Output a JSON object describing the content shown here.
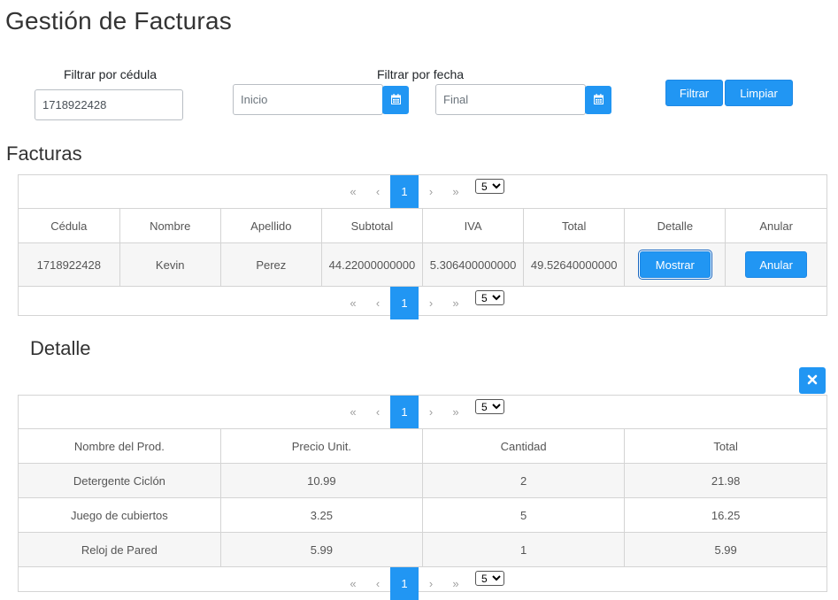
{
  "title": "Gestión de Facturas",
  "filters": {
    "cedula_label": "Filtrar por cédula",
    "cedula_value": "1718922428",
    "fecha_label": "Filtrar por fecha",
    "inicio_placeholder": "Inicio",
    "final_placeholder": "Final",
    "filtrar_label": "Filtrar",
    "limpiar_label": "Limpiar"
  },
  "facturas": {
    "title": "Facturas",
    "paginator": {
      "first": "«",
      "prev": "‹",
      "page": "1",
      "next": "›",
      "last": "»",
      "rows": "5"
    },
    "columns": [
      "Cédula",
      "Nombre",
      "Apellido",
      "Subtotal",
      "IVA",
      "Total",
      "Detalle",
      "Anular"
    ],
    "rows": [
      {
        "cedula": "1718922428",
        "nombre": "Kevin",
        "apellido": "Perez",
        "subtotal": "44.22000000000",
        "iva": "5.306400000000",
        "total": "49.52640000000",
        "detalle_btn": "Mostrar",
        "anular_btn": "Anular"
      }
    ]
  },
  "detalle": {
    "title": "Detalle",
    "paginator": {
      "first": "«",
      "prev": "‹",
      "page": "1",
      "next": "›",
      "last": "»",
      "rows": "5"
    },
    "columns": [
      "Nombre del Prod.",
      "Precio Unit.",
      "Cantidad",
      "Total"
    ],
    "rows": [
      {
        "nombre": "Detergente Ciclón",
        "precio": "10.99",
        "cantidad": "2",
        "total": "21.98"
      },
      {
        "nombre": "Juego de cubiertos",
        "precio": "3.25",
        "cantidad": "5",
        "total": "16.25"
      },
      {
        "nombre": "Reloj de Pared",
        "precio": "5.99",
        "cantidad": "1",
        "total": "5.99"
      }
    ]
  },
  "icons": {
    "calendar": "calendar-icon",
    "close": "close-icon"
  },
  "colors": {
    "accent": "#2196f3",
    "border": "#d4d4d4",
    "stripe": "#f6f6f6"
  }
}
